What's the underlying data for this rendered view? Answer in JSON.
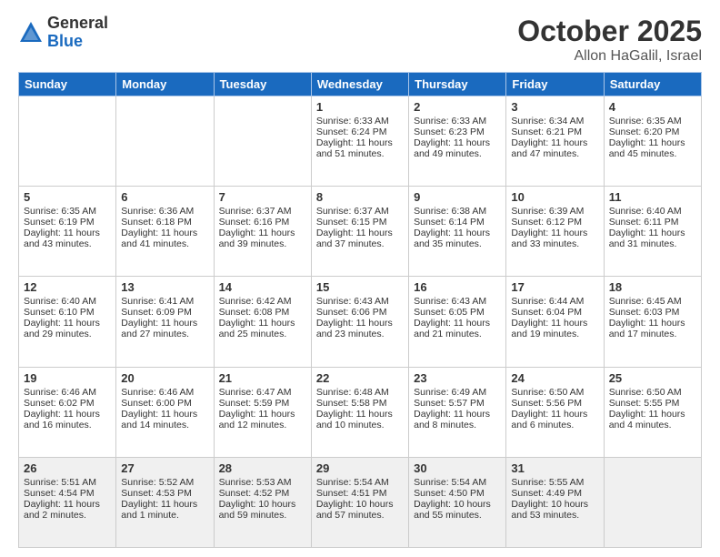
{
  "header": {
    "logo_general": "General",
    "logo_blue": "Blue",
    "month": "October 2025",
    "location": "Allon HaGalil, Israel"
  },
  "days_of_week": [
    "Sunday",
    "Monday",
    "Tuesday",
    "Wednesday",
    "Thursday",
    "Friday",
    "Saturday"
  ],
  "weeks": [
    [
      {
        "day": "",
        "sunrise": "",
        "sunset": "",
        "daylight": ""
      },
      {
        "day": "",
        "sunrise": "",
        "sunset": "",
        "daylight": ""
      },
      {
        "day": "",
        "sunrise": "",
        "sunset": "",
        "daylight": ""
      },
      {
        "day": "1",
        "sunrise": "Sunrise: 6:33 AM",
        "sunset": "Sunset: 6:24 PM",
        "daylight": "Daylight: 11 hours and 51 minutes."
      },
      {
        "day": "2",
        "sunrise": "Sunrise: 6:33 AM",
        "sunset": "Sunset: 6:23 PM",
        "daylight": "Daylight: 11 hours and 49 minutes."
      },
      {
        "day": "3",
        "sunrise": "Sunrise: 6:34 AM",
        "sunset": "Sunset: 6:21 PM",
        "daylight": "Daylight: 11 hours and 47 minutes."
      },
      {
        "day": "4",
        "sunrise": "Sunrise: 6:35 AM",
        "sunset": "Sunset: 6:20 PM",
        "daylight": "Daylight: 11 hours and 45 minutes."
      }
    ],
    [
      {
        "day": "5",
        "sunrise": "Sunrise: 6:35 AM",
        "sunset": "Sunset: 6:19 PM",
        "daylight": "Daylight: 11 hours and 43 minutes."
      },
      {
        "day": "6",
        "sunrise": "Sunrise: 6:36 AM",
        "sunset": "Sunset: 6:18 PM",
        "daylight": "Daylight: 11 hours and 41 minutes."
      },
      {
        "day": "7",
        "sunrise": "Sunrise: 6:37 AM",
        "sunset": "Sunset: 6:16 PM",
        "daylight": "Daylight: 11 hours and 39 minutes."
      },
      {
        "day": "8",
        "sunrise": "Sunrise: 6:37 AM",
        "sunset": "Sunset: 6:15 PM",
        "daylight": "Daylight: 11 hours and 37 minutes."
      },
      {
        "day": "9",
        "sunrise": "Sunrise: 6:38 AM",
        "sunset": "Sunset: 6:14 PM",
        "daylight": "Daylight: 11 hours and 35 minutes."
      },
      {
        "day": "10",
        "sunrise": "Sunrise: 6:39 AM",
        "sunset": "Sunset: 6:12 PM",
        "daylight": "Daylight: 11 hours and 33 minutes."
      },
      {
        "day": "11",
        "sunrise": "Sunrise: 6:40 AM",
        "sunset": "Sunset: 6:11 PM",
        "daylight": "Daylight: 11 hours and 31 minutes."
      }
    ],
    [
      {
        "day": "12",
        "sunrise": "Sunrise: 6:40 AM",
        "sunset": "Sunset: 6:10 PM",
        "daylight": "Daylight: 11 hours and 29 minutes."
      },
      {
        "day": "13",
        "sunrise": "Sunrise: 6:41 AM",
        "sunset": "Sunset: 6:09 PM",
        "daylight": "Daylight: 11 hours and 27 minutes."
      },
      {
        "day": "14",
        "sunrise": "Sunrise: 6:42 AM",
        "sunset": "Sunset: 6:08 PM",
        "daylight": "Daylight: 11 hours and 25 minutes."
      },
      {
        "day": "15",
        "sunrise": "Sunrise: 6:43 AM",
        "sunset": "Sunset: 6:06 PM",
        "daylight": "Daylight: 11 hours and 23 minutes."
      },
      {
        "day": "16",
        "sunrise": "Sunrise: 6:43 AM",
        "sunset": "Sunset: 6:05 PM",
        "daylight": "Daylight: 11 hours and 21 minutes."
      },
      {
        "day": "17",
        "sunrise": "Sunrise: 6:44 AM",
        "sunset": "Sunset: 6:04 PM",
        "daylight": "Daylight: 11 hours and 19 minutes."
      },
      {
        "day": "18",
        "sunrise": "Sunrise: 6:45 AM",
        "sunset": "Sunset: 6:03 PM",
        "daylight": "Daylight: 11 hours and 17 minutes."
      }
    ],
    [
      {
        "day": "19",
        "sunrise": "Sunrise: 6:46 AM",
        "sunset": "Sunset: 6:02 PM",
        "daylight": "Daylight: 11 hours and 16 minutes."
      },
      {
        "day": "20",
        "sunrise": "Sunrise: 6:46 AM",
        "sunset": "Sunset: 6:00 PM",
        "daylight": "Daylight: 11 hours and 14 minutes."
      },
      {
        "day": "21",
        "sunrise": "Sunrise: 6:47 AM",
        "sunset": "Sunset: 5:59 PM",
        "daylight": "Daylight: 11 hours and 12 minutes."
      },
      {
        "day": "22",
        "sunrise": "Sunrise: 6:48 AM",
        "sunset": "Sunset: 5:58 PM",
        "daylight": "Daylight: 11 hours and 10 minutes."
      },
      {
        "day": "23",
        "sunrise": "Sunrise: 6:49 AM",
        "sunset": "Sunset: 5:57 PM",
        "daylight": "Daylight: 11 hours and 8 minutes."
      },
      {
        "day": "24",
        "sunrise": "Sunrise: 6:50 AM",
        "sunset": "Sunset: 5:56 PM",
        "daylight": "Daylight: 11 hours and 6 minutes."
      },
      {
        "day": "25",
        "sunrise": "Sunrise: 6:50 AM",
        "sunset": "Sunset: 5:55 PM",
        "daylight": "Daylight: 11 hours and 4 minutes."
      }
    ],
    [
      {
        "day": "26",
        "sunrise": "Sunrise: 5:51 AM",
        "sunset": "Sunset: 4:54 PM",
        "daylight": "Daylight: 11 hours and 2 minutes."
      },
      {
        "day": "27",
        "sunrise": "Sunrise: 5:52 AM",
        "sunset": "Sunset: 4:53 PM",
        "daylight": "Daylight: 11 hours and 1 minute."
      },
      {
        "day": "28",
        "sunrise": "Sunrise: 5:53 AM",
        "sunset": "Sunset: 4:52 PM",
        "daylight": "Daylight: 10 hours and 59 minutes."
      },
      {
        "day": "29",
        "sunrise": "Sunrise: 5:54 AM",
        "sunset": "Sunset: 4:51 PM",
        "daylight": "Daylight: 10 hours and 57 minutes."
      },
      {
        "day": "30",
        "sunrise": "Sunrise: 5:54 AM",
        "sunset": "Sunset: 4:50 PM",
        "daylight": "Daylight: 10 hours and 55 minutes."
      },
      {
        "day": "31",
        "sunrise": "Sunrise: 5:55 AM",
        "sunset": "Sunset: 4:49 PM",
        "daylight": "Daylight: 10 hours and 53 minutes."
      },
      {
        "day": "",
        "sunrise": "",
        "sunset": "",
        "daylight": ""
      }
    ]
  ]
}
